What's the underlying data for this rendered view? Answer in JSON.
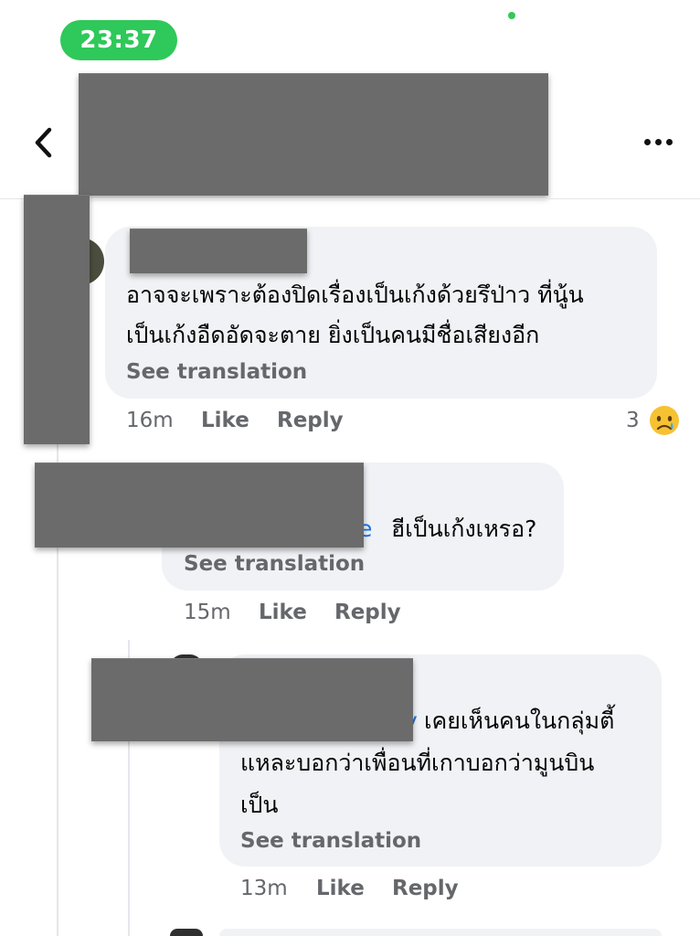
{
  "status_bar": {
    "time": "23:37"
  },
  "header": {
    "back_icon": "chevron-left-icon",
    "more_icon": "more-dots-icon"
  },
  "comments": [
    {
      "lines": [
        "อาจจะเพราะต้องปิดเรื่องเป็นเก้งด้วยรึป่าว ที่นู้น",
        "เป็นเก้งอืดอัดจะตาย ยิ่งเป็นคนมีชื่อเสียงอีก"
      ],
      "see_translation": "See translation",
      "time": "16m",
      "like": "Like",
      "reply": "Reply",
      "reaction_count": "3",
      "reaction_icon": "sad-tear-emoji-icon"
    },
    {
      "mention_fragment": "e",
      "text": "ฮีเป็นเก้งเหรอ?",
      "see_translation": "See translation",
      "time": "15m",
      "like": "Like",
      "reply": "Reply"
    },
    {
      "mention_fragment": "y",
      "lines": [
        "เคยเห็นคนในกลุ่มตี้",
        "แหละบอกว่าเพื่อนที่เกาบอกว่ามูนบิน",
        "เป็น"
      ],
      "see_translation": "See translation",
      "time": "13m",
      "like": "Like",
      "reply": "Reply"
    }
  ],
  "colors": {
    "time_pill": "#2fc85a",
    "bubble": "#f0f2f5",
    "meta": "#65676b",
    "mention": "#1b74e4",
    "redaction": "#6b6b6b"
  }
}
